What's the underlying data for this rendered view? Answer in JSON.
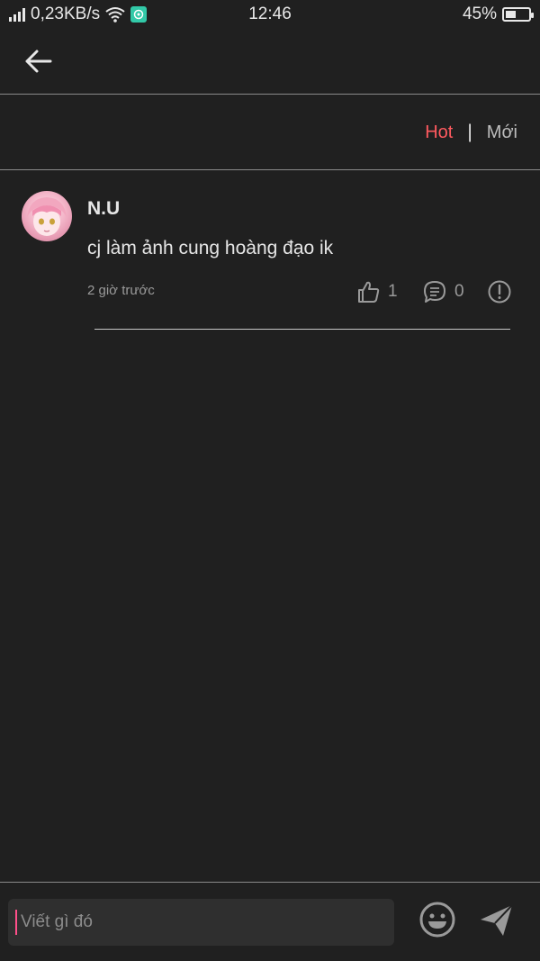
{
  "status_bar": {
    "network_speed": "0,23KB/s",
    "time": "12:46",
    "battery_percent": "45%",
    "battery_level": 0.45,
    "icons": [
      "signal-icon",
      "wifi-icon",
      "vpn-icon",
      "battery-icon"
    ]
  },
  "header": {
    "back_icon": "arrow-left-icon"
  },
  "sort": {
    "hot_label": "Hot",
    "separator": "|",
    "new_label": "Mới",
    "active": "hot"
  },
  "comments": [
    {
      "username": "N.U",
      "text": "cj làm ảnh cung hoàng đạo ik",
      "time": "2 giờ trước",
      "likes": "1",
      "replies": "0"
    }
  ],
  "composer": {
    "placeholder": "Viết gì đó",
    "emoji_icon": "emoji-icon",
    "send_icon": "send-icon"
  },
  "colors": {
    "background": "#202020",
    "accent_hot": "#ff5a5f",
    "muted": "#9a9a9a",
    "caret": "#ff4f8a"
  }
}
